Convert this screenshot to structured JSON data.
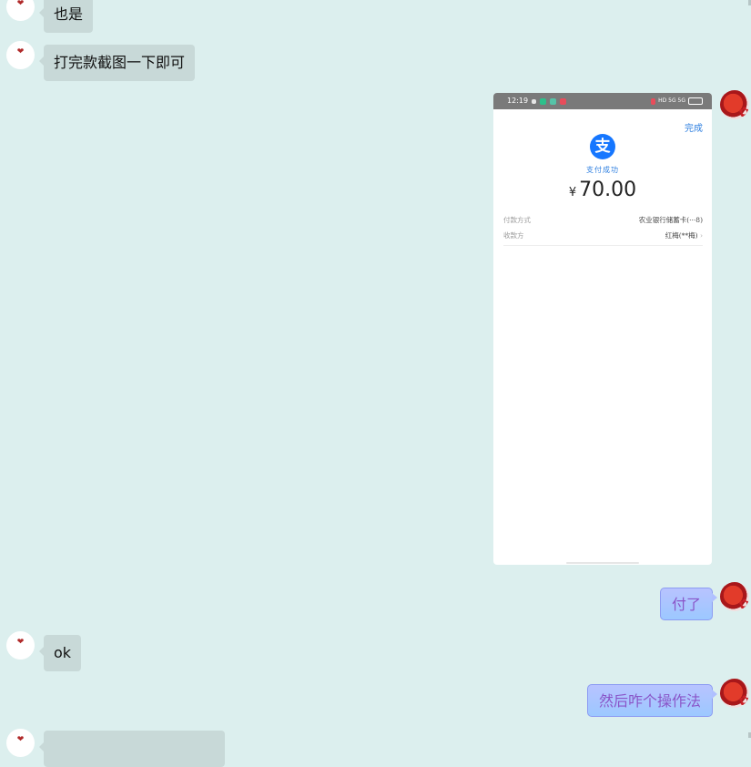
{
  "messages": [
    {
      "side": "left",
      "text": "也是"
    },
    {
      "side": "left",
      "text": "打完款截图一下即可"
    },
    {
      "side": "right",
      "type": "image"
    },
    {
      "side": "right",
      "text": "付了"
    },
    {
      "side": "left",
      "text": "ok"
    },
    {
      "side": "right",
      "text": "然后咋个操作法"
    }
  ],
  "screenshot": {
    "status_time": "12:19",
    "status_right": "HD 5G 5G",
    "done_label": "完成",
    "pay_icon": "支",
    "success_text": "支付成功",
    "currency": "¥",
    "amount": "70.00",
    "rows": [
      {
        "label": "付款方式",
        "value": "农业银行储蓄卡(···8)"
      },
      {
        "label": "收款方",
        "value": "红梅(**梅)"
      }
    ]
  },
  "colors": {
    "background": "#dcefee",
    "left_bubble": "#c8d9d8",
    "right_bubble": "#b8c3ff",
    "right_text": "#8a55c8",
    "alipay_blue": "#1677ff"
  },
  "icons": {
    "left_avatar": "heart-avatar-icon",
    "right_avatar": "red-flower-avatar-icon"
  }
}
